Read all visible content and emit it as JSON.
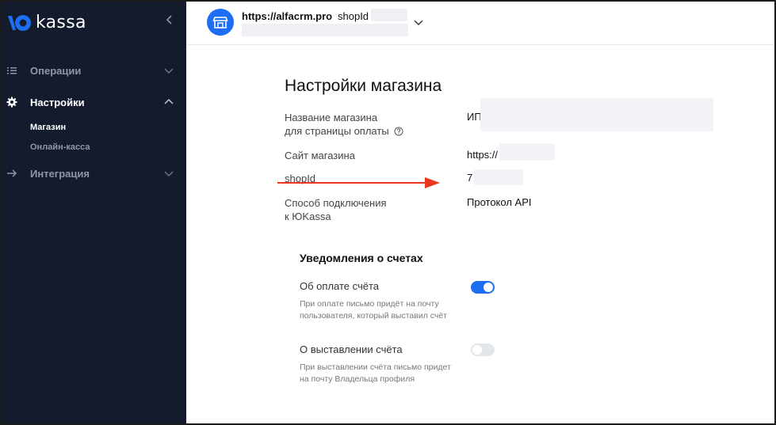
{
  "brand": {
    "logo_text": "kassa"
  },
  "sidebar": {
    "items": [
      {
        "label": "Операции",
        "icon": "list-icon",
        "expanded": false
      },
      {
        "label": "Настройки",
        "icon": "gear-icon",
        "expanded": true,
        "children": [
          {
            "label": "Магазин",
            "active": true
          },
          {
            "label": "Онлайн-касса",
            "active": false
          }
        ]
      },
      {
        "label": "Интеграция",
        "icon": "arrow-right-icon",
        "expanded": false
      }
    ]
  },
  "header": {
    "shop_url": "https://alfacrm.pro",
    "shop_id_label": "shopId"
  },
  "main": {
    "title": "Настройки магазина",
    "rows": [
      {
        "label_line1": "Название магазина",
        "label_line2": "для страницы оплаты",
        "value": "ИП"
      },
      {
        "label_line1": "Сайт магазина",
        "label_line2": "",
        "value": "https://"
      },
      {
        "label_line1": "shopId",
        "label_line2": "",
        "value": "7"
      },
      {
        "label_line1": "Способ подключения",
        "label_line2": "к ЮKassa",
        "value": "Протокол API"
      }
    ],
    "notifications": {
      "title": "Уведомления о счетах",
      "toggles": [
        {
          "label": "Об оплате счёта",
          "desc_line1": "При оплате письмо придёт на почту",
          "desc_line2": "пользователя, который выставил счёт",
          "enabled": true
        },
        {
          "label": "О выставлении счёта",
          "desc_line1": "При выставлении счёта письмо придет",
          "desc_line2": "на почту Владельца профиля",
          "enabled": false
        }
      ]
    }
  },
  "colors": {
    "sidebar_bg": "#141b2d",
    "accent": "#1e6ef4",
    "annotation_arrow": "#e8361f"
  }
}
